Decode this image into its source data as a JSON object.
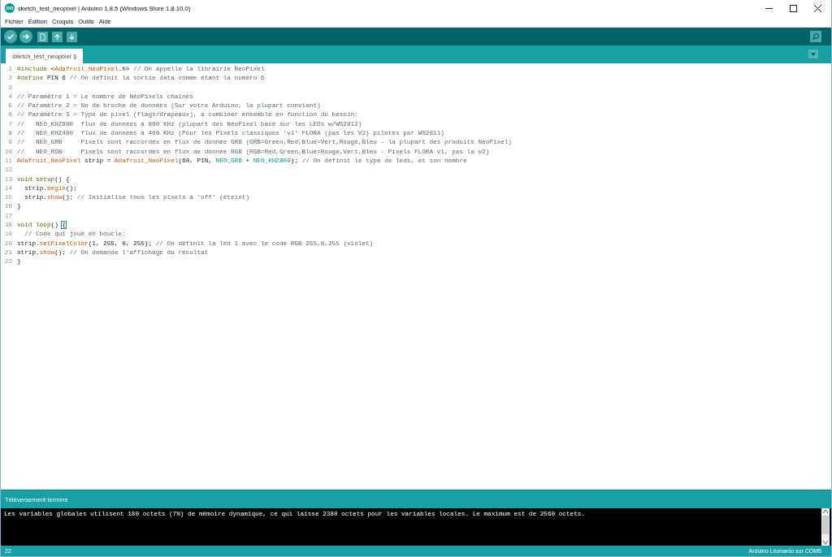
{
  "window": {
    "title": "sketch_test_neopixel | Arduino 1.8.5 (Windows Store 1.8.10.0)"
  },
  "menu_bar": [
    "Fichier",
    "Édition",
    "Croquis",
    "Outils",
    "Aide"
  ],
  "tabs": [
    {
      "label": "sketch_test_neopixel §",
      "selected": true
    }
  ],
  "editor": {
    "lines": [
      {
        "number": "1",
        "tokens": [
          {
            "text": "#include",
            "kind": "keyword"
          },
          {
            "text": " <",
            "kind": "plain"
          },
          {
            "text": "Adafruit_NeoPixel",
            "kind": "type"
          },
          {
            "text": ".h> ",
            "kind": "plain"
          },
          {
            "text": "// On appelle la librairie NeoPixel",
            "kind": "comment"
          }
        ]
      },
      {
        "number": "2",
        "tokens": [
          {
            "text": "#define",
            "kind": "keyword"
          },
          {
            "text": " PIN 6 ",
            "kind": "plain"
          },
          {
            "text": "// On définit la sortie data comme étant la numéro 6",
            "kind": "comment"
          }
        ]
      },
      {
        "number": "3"
      },
      {
        "number": "4",
        "tokens": [
          {
            "text": "// Paramètre 1 = Le nombre de NéoPixels chainés",
            "kind": "comment"
          }
        ]
      },
      {
        "number": "5",
        "tokens": [
          {
            "text": "// Paramètre 2 = No de broche de données (Sur votre Arduino, la plupart convient)",
            "kind": "comment"
          }
        ]
      },
      {
        "number": "6",
        "tokens": [
          {
            "text": "// Paramètre 3 = Type de pixel (flags/drapeaux), a combiner ensemble en fonction du besoin:",
            "kind": "comment"
          }
        ]
      },
      {
        "number": "7",
        "tokens": [
          {
            "text": "//   NEO_KHZ800  flux de données à 800 KHz (plupart des NéoPixel basé sur les LEDs w/WS2812)",
            "kind": "comment"
          }
        ]
      },
      {
        "number": "8",
        "tokens": [
          {
            "text": "//   NEO_KHZ400  flux de données à 400 KHz (Pour les Pixels classiques 'v1' FLORA (pas les V2) pilotés par WS2811)",
            "kind": "comment"
          }
        ]
      },
      {
        "number": "9",
        "tokens": [
          {
            "text": "//   NEO_GRB     Pixels sont raccordés en flux de donnée GRB (GRB=Green,Red,Blue=Vert,Rouge,Bleu - la plupart des produits NéoPixel)",
            "kind": "comment"
          }
        ]
      },
      {
        "number": "10",
        "tokens": [
          {
            "text": "//   NEO_RGB     Pixels sont raccordés en flux de donnée RGB (RGB=Red,Green,Blue=Rouge,Vert,Bleu - Pixels FLORA v1, pas la v2)",
            "kind": "comment"
          }
        ]
      },
      {
        "number": "11",
        "tokens": [
          {
            "text": "Adafruit_NeoPixel",
            "kind": "type"
          },
          {
            "text": " strip = ",
            "kind": "plain"
          },
          {
            "text": "Adafruit_NeoPixel",
            "kind": "type"
          },
          {
            "text": "(60, PIN, ",
            "kind": "plain"
          },
          {
            "text": "NEO_GRB",
            "kind": "constant"
          },
          {
            "text": " + ",
            "kind": "plain"
          },
          {
            "text": "NEO_KHZ800",
            "kind": "constant"
          },
          {
            "text": "); ",
            "kind": "plain"
          },
          {
            "text": "// On définit le type de leds, et son nombre",
            "kind": "comment"
          }
        ]
      },
      {
        "number": "12"
      },
      {
        "number": "13",
        "tokens": [
          {
            "text": "void setup",
            "kind": "keyword"
          },
          {
            "text": "() {",
            "kind": "plain"
          }
        ]
      },
      {
        "number": "14",
        "tokens": [
          {
            "text": "  strip.",
            "kind": "plain"
          },
          {
            "text": "begin",
            "kind": "function"
          },
          {
            "text": "();",
            "kind": "plain"
          }
        ]
      },
      {
        "number": "15",
        "tokens": [
          {
            "text": "  strip.",
            "kind": "plain"
          },
          {
            "text": "show",
            "kind": "function"
          },
          {
            "text": "(); ",
            "kind": "plain"
          },
          {
            "text": "// Initialise tous les pixels à 'off' (éteint)",
            "kind": "comment"
          }
        ]
      },
      {
        "number": "16",
        "tokens": [
          {
            "text": "}",
            "kind": "plain"
          }
        ]
      },
      {
        "number": "17"
      },
      {
        "number": "18",
        "tokens": [
          {
            "text": "void loop",
            "kind": "keyword"
          },
          {
            "text": "() ",
            "kind": "plain"
          },
          {
            "text": "{",
            "kind": "matched-bracket"
          }
        ]
      },
      {
        "number": "19",
        "tokens": [
          {
            "text": "  // Code qui joué en boucle:",
            "kind": "comment"
          }
        ]
      },
      {
        "number": "20",
        "tokens": [
          {
            "text": "strip.",
            "kind": "plain"
          },
          {
            "text": "setPixelColor",
            "kind": "function"
          },
          {
            "text": "(1, 255, 0, 255); ",
            "kind": "plain"
          },
          {
            "text": "// On définit la led 1 avec le code RGB 255,0,255 (violet)",
            "kind": "comment"
          }
        ]
      },
      {
        "number": "21",
        "tokens": [
          {
            "text": "strip.",
            "kind": "plain"
          },
          {
            "text": "show",
            "kind": "function"
          },
          {
            "text": "(); ",
            "kind": "plain"
          },
          {
            "text": "// On demande l'affichage du résultat",
            "kind": "comment"
          }
        ]
      },
      {
        "number": "22",
        "tokens": [
          {
            "text": "}",
            "kind": "plain"
          }
        ]
      }
    ]
  },
  "message_bar": {
    "text": "Téléversement terminé"
  },
  "console": {
    "lines": [
      "Les variables globales utilisent 180 octets (7%) de mémoire dynamique, ce qui laisse 2380 octets pour les variables locales. Le maximum est de 2560 octets."
    ]
  },
  "status_bar": {
    "line": "22",
    "board": "Arduino Leonardo sur COM5"
  }
}
